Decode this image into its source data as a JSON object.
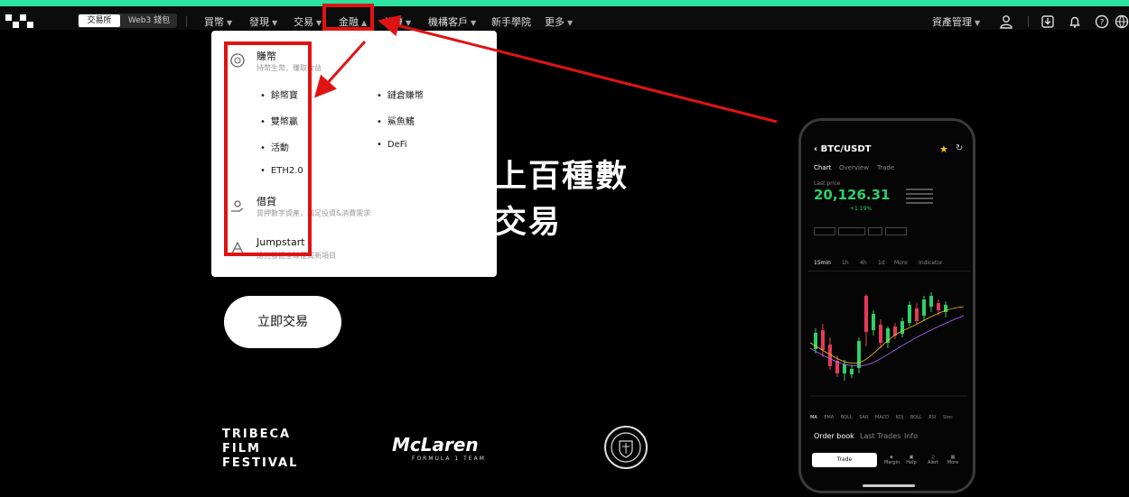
{
  "topnav": {
    "segment": {
      "active": "交易所",
      "inactive": "Web3 錢包"
    },
    "items": [
      {
        "label": "買幣"
      },
      {
        "label": "發現"
      },
      {
        "label": "交易"
      },
      {
        "label": "金融"
      },
      {
        "label": "公鏈"
      },
      {
        "label": "機構客戶"
      },
      {
        "label": "新手學院"
      },
      {
        "label": "更多"
      }
    ],
    "asset_mgmt": "資產管理"
  },
  "dropdown": {
    "earn": {
      "title": "賺幣",
      "subtitle": "持幣生幣，賺取收益",
      "items": [
        "餘幣寶",
        "雙幣贏",
        "活動",
        "ETH2.0",
        "鏈倉賺幣",
        "鯊魚鰭",
        "DeFi"
      ]
    },
    "loan": {
      "title": "借貸",
      "subtitle": "質押數字資產，滿足投資&消費需求"
    },
    "jumpstart": {
      "title": "Jumpstart",
      "subtitle": "搶先發掘全球優質新項目"
    }
  },
  "hero": {
    "line1": "上百種數",
    "line2": "交易"
  },
  "cta": {
    "label": "立即交易"
  },
  "partners": {
    "tribeca": [
      "TRIBECA",
      "FILM",
      "FESTIVAL"
    ],
    "mclaren": "McLaren",
    "mclaren_sub": "FORMULA 1 TEAM"
  },
  "phone": {
    "pair": "BTC/USDT",
    "tabs": [
      "Chart",
      "Overview",
      "Trade"
    ],
    "last_price_label": "Last price",
    "price": "20,126.31",
    "change": "+1.19%",
    "timeframes": [
      "15min",
      "1h",
      "4h",
      "1d",
      "More",
      "Indicator"
    ],
    "indicators": [
      "MA",
      "EMA",
      "BOLL",
      "SAR",
      "MACD",
      "KDJ",
      "BOLL",
      "RSI",
      "Stoc"
    ],
    "bottom_tabs": [
      "Order book",
      "Last Trades",
      "Info"
    ],
    "trade_button": "Trade",
    "bottom_icons": [
      "Margin",
      "Help",
      "Alert",
      "More"
    ]
  },
  "colors": {
    "accent": "#2de3a0",
    "annotation": "#e01313",
    "up": "#2ecf6a",
    "down": "#e33a5a"
  }
}
